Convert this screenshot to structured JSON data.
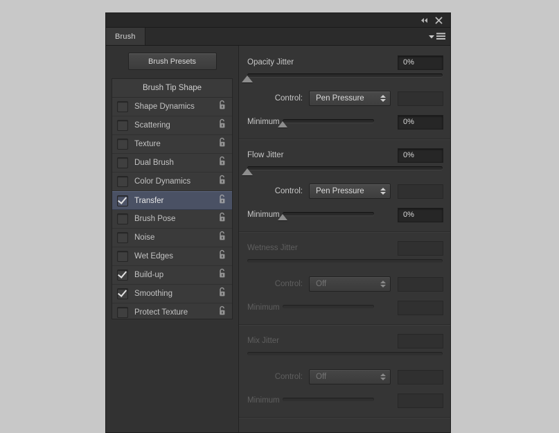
{
  "titlebar": {
    "collapse_icon": "double-left-arrow-icon",
    "close_icon": "close-icon"
  },
  "tabs": [
    {
      "label": "Brush",
      "active": true
    }
  ],
  "flyout_menu_icon": "panel-menu-icon",
  "sidebar": {
    "presets_button": "Brush Presets",
    "list_header": "Brush Tip Shape",
    "items": [
      {
        "label": "Shape Dynamics",
        "checked": false,
        "locked": false
      },
      {
        "label": "Scattering",
        "checked": false,
        "locked": false
      },
      {
        "label": "Texture",
        "checked": false,
        "locked": false
      },
      {
        "label": "Dual Brush",
        "checked": false,
        "locked": false
      },
      {
        "label": "Color Dynamics",
        "checked": false,
        "locked": false
      },
      {
        "label": "Transfer",
        "checked": true,
        "locked": false,
        "selected": true
      },
      {
        "label": "Brush Pose",
        "checked": false,
        "locked": false
      },
      {
        "label": "Noise",
        "checked": false,
        "locked": false
      },
      {
        "label": "Wet Edges",
        "checked": false,
        "locked": false
      },
      {
        "label": "Build-up",
        "checked": true,
        "locked": false
      },
      {
        "label": "Smoothing",
        "checked": true,
        "locked": false
      },
      {
        "label": "Protect Texture",
        "checked": false,
        "locked": false
      }
    ]
  },
  "transfer": {
    "control_label": "Control:",
    "minimum_label": "Minimum",
    "sections": [
      {
        "title": "Opacity Jitter",
        "value": "0%",
        "jitter_percent": 0,
        "control": "Pen Pressure",
        "control_extra_value": "",
        "minimum": "0%",
        "minimum_percent": 0,
        "enabled": true
      },
      {
        "title": "Flow Jitter",
        "value": "0%",
        "jitter_percent": 0,
        "control": "Pen Pressure",
        "control_extra_value": "",
        "minimum": "0%",
        "minimum_percent": 0,
        "enabled": true
      },
      {
        "title": "Wetness Jitter",
        "value": "",
        "jitter_percent": 0,
        "control": "Off",
        "control_extra_value": "",
        "minimum": "",
        "minimum_percent": 0,
        "enabled": false
      },
      {
        "title": "Mix Jitter",
        "value": "",
        "jitter_percent": 0,
        "control": "Off",
        "control_extra_value": "",
        "minimum": "",
        "minimum_percent": 0,
        "enabled": false
      }
    ]
  },
  "colors": {
    "panel_bg": "#323232",
    "right_bg": "#353535",
    "selected_row": "#4a5164",
    "text": "#c8c8c8",
    "dim_text": "#5f5f5f"
  }
}
